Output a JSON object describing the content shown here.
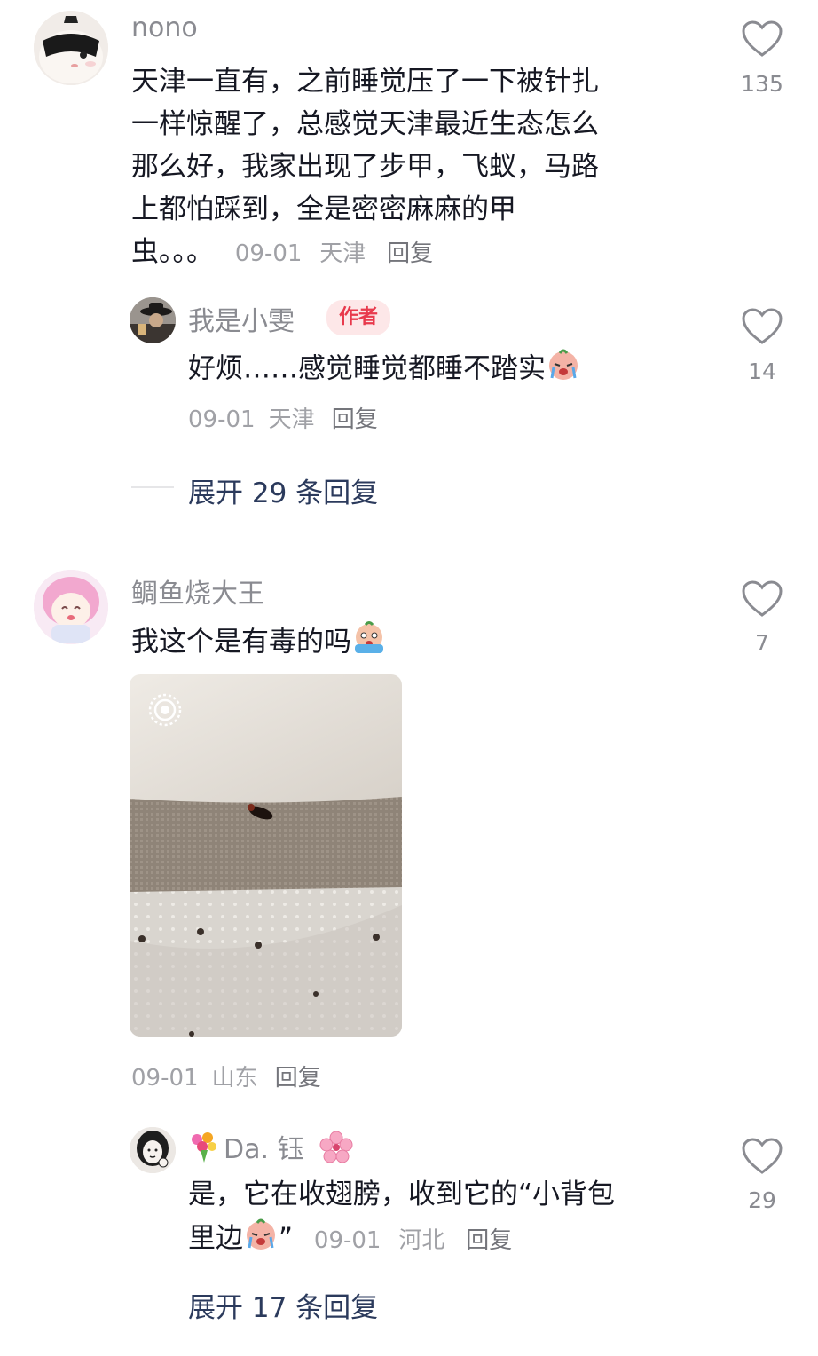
{
  "comments": [
    {
      "username": "nono",
      "text": "天津一直有，之前睡觉压了一下被针扎一样惊醒了，总感觉天津最近生态怎么那么好，我家出现了步甲，飞蚁，马路上都怕踩到，全是密密麻麻的甲虫。。。",
      "lines": [
        "天津一直有，之前睡觉压了一下被针扎",
        "一样惊醒了，总感觉天津最近生态怎么",
        "那么好，我家出现了步甲，飞蚁，马路",
        "上都怕踩到，全是密密麻麻的甲"
      ],
      "last_line": "虫。。。",
      "date": "09-01",
      "location": "天津",
      "reply_label": "回复",
      "likes": "135"
    },
    {
      "username": "我是小雯",
      "badge": "作者",
      "text": "好烦……感觉睡觉都睡不踏实",
      "date": "09-01",
      "location": "天津",
      "reply_label": "回复",
      "likes": "14"
    },
    {
      "expand_label": "展开 29 条回复"
    },
    {
      "username": "鲷鱼烧大王",
      "text": "我这个是有毒的吗",
      "date": "09-01",
      "location": "山东",
      "reply_label": "回复",
      "likes": "7"
    },
    {
      "username": "Da. 钰",
      "text_line1": "是，它在收翅膀，收到它的“小背包",
      "text_line2": "里边",
      "closing_quote": "”",
      "date": "09-01",
      "location": "河北",
      "reply_label": "回复",
      "likes": "29"
    },
    {
      "expand_label": "展开 17 条回复"
    }
  ],
  "icons": {
    "like": "heart-outline-icon",
    "live_photo": "live-photo-icon"
  },
  "colors": {
    "text": "#161823",
    "meta": "#a0a1a6",
    "badge_bg": "#fde7e8",
    "badge_text": "#e8394c",
    "expand": "#2b3a5c"
  }
}
